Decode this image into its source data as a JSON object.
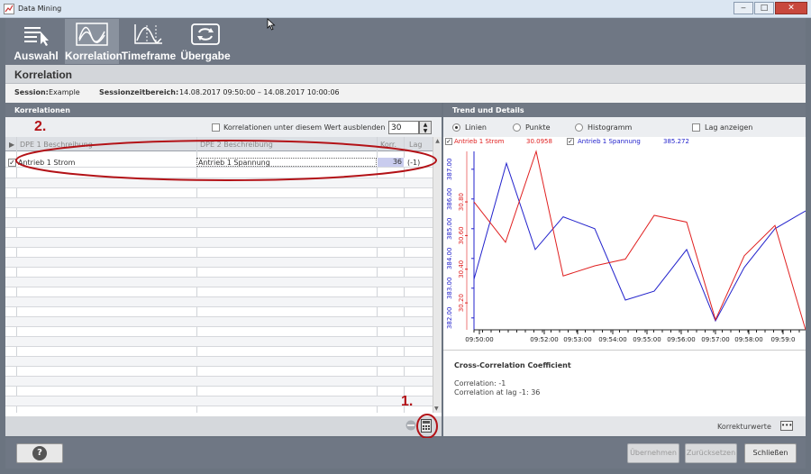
{
  "window": {
    "title": "Data Mining"
  },
  "toolbar": {
    "items": [
      {
        "label": "Auswahl",
        "icon": "list-cursor-icon"
      },
      {
        "label": "Korrelation",
        "icon": "waves-icon",
        "active": true
      },
      {
        "label": "Timeframe",
        "icon": "timeframe-chart-icon"
      },
      {
        "label": "Übergabe",
        "icon": "transfer-icon"
      }
    ]
  },
  "page": {
    "title": "Korrelation",
    "session_label": "Session:",
    "session_value": "Example",
    "range_label": "Sessionzeitbereich:",
    "range_value": "14.08.2017 09:50:00 – 14.08.2017 10:00:06"
  },
  "left": {
    "heading": "Korrelationen",
    "hide_label": "Korrelationen unter diesem Wert ausblenden",
    "threshold": "30",
    "columns": [
      "DPE 1 Beschreibung",
      "DPE 2 Beschreibung",
      "Korr.",
      "Lag"
    ],
    "rows": [
      {
        "checked": "✓",
        "dpe1": "Antrieb 1 Strom",
        "dpe2": "Antrieb 1 Spannung",
        "korr": "36",
        "lag": "(-1)"
      }
    ]
  },
  "right": {
    "heading": "Trend und Details",
    "modes": [
      "Linien",
      "Punkte",
      "Histogramm"
    ],
    "lag_label": "Lag anzeigen",
    "legend": [
      {
        "name": "Antrieb 1 Strom",
        "value": "30.0958",
        "color": "#e02020"
      },
      {
        "name": "Antrieb 1 Spannung",
        "value": "385.272",
        "color": "#2222cc"
      }
    ],
    "details_title": "Cross-Correlation Coefficient",
    "details_lines": [
      "Correlation: -1",
      "Correlation at lag -1: 36"
    ],
    "footer_label": "Korrekturwerte"
  },
  "chart_data": {
    "type": "line",
    "x": [
      "09:50:00",
      "09:50:30",
      "09:51:00",
      "09:51:30",
      "09:52:00",
      "09:52:30",
      "09:53:00",
      "09:53:30",
      "09:54:00",
      "09:54:30",
      "09:55:00",
      "09:55:30",
      "09:56:00",
      "09:56:30",
      "09:57:00",
      "09:57:30",
      "09:58:00",
      "09:58:30",
      "09:59:00"
    ],
    "xticks": [
      "09:50:00",
      "09:52:00",
      "09:53:00",
      "09:54:00",
      "09:55:00",
      "09:56:00",
      "09:57:00",
      "09:58:00",
      "09:59:0"
    ],
    "series": [
      {
        "name": "Antrieb 1 Spannung",
        "color": "#2222cc",
        "values": [
          383.3,
          387.2,
          384.3,
          385.4,
          385.0,
          382.6,
          382.9,
          384.3,
          381.9,
          383.7,
          385.0,
          385.6
        ]
      },
      {
        "name": "Antrieb 1 Strom",
        "color": "#e02020",
        "values": [
          30.8,
          30.56,
          31.1,
          30.36,
          30.42,
          30.46,
          30.72,
          30.68,
          30.1,
          30.48,
          30.66,
          30.04
        ]
      }
    ],
    "y_left_ticks": [
      "382.00",
      "383.00",
      "384.00",
      "385.00",
      "386.00",
      "387.00"
    ],
    "y_right_ticks": [
      "30.20",
      "30.40",
      "30.60",
      "30.80"
    ]
  },
  "buttons": {
    "help": "?",
    "apply": "Übernehmen",
    "reset": "Zurücksetzen",
    "close": "Schließen"
  },
  "annotations": [
    "1.",
    "2."
  ]
}
